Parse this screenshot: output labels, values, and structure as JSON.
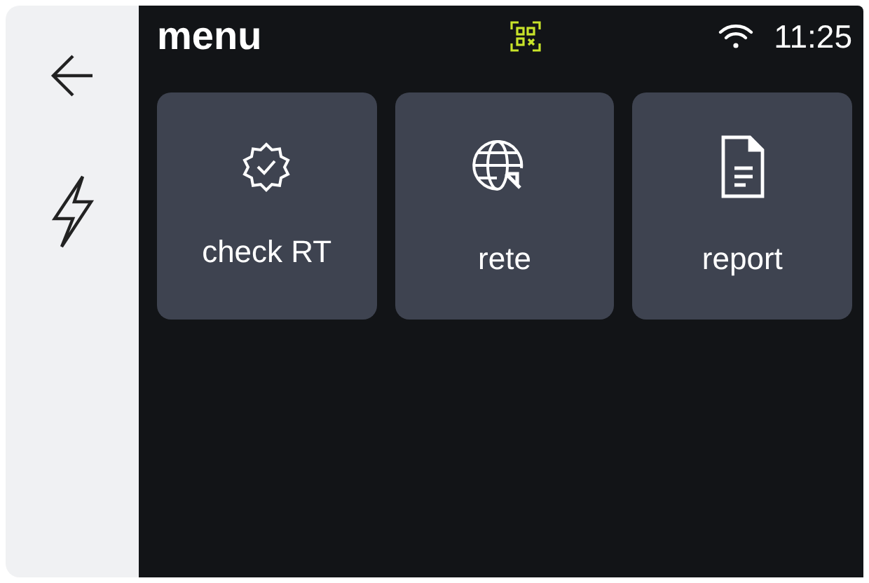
{
  "header": {
    "title": "menu",
    "time": "11:25"
  },
  "tiles": [
    {
      "label": "check RT",
      "kind": "badge"
    },
    {
      "label": "rete",
      "kind": "globe"
    },
    {
      "label": "report",
      "kind": "document"
    }
  ]
}
